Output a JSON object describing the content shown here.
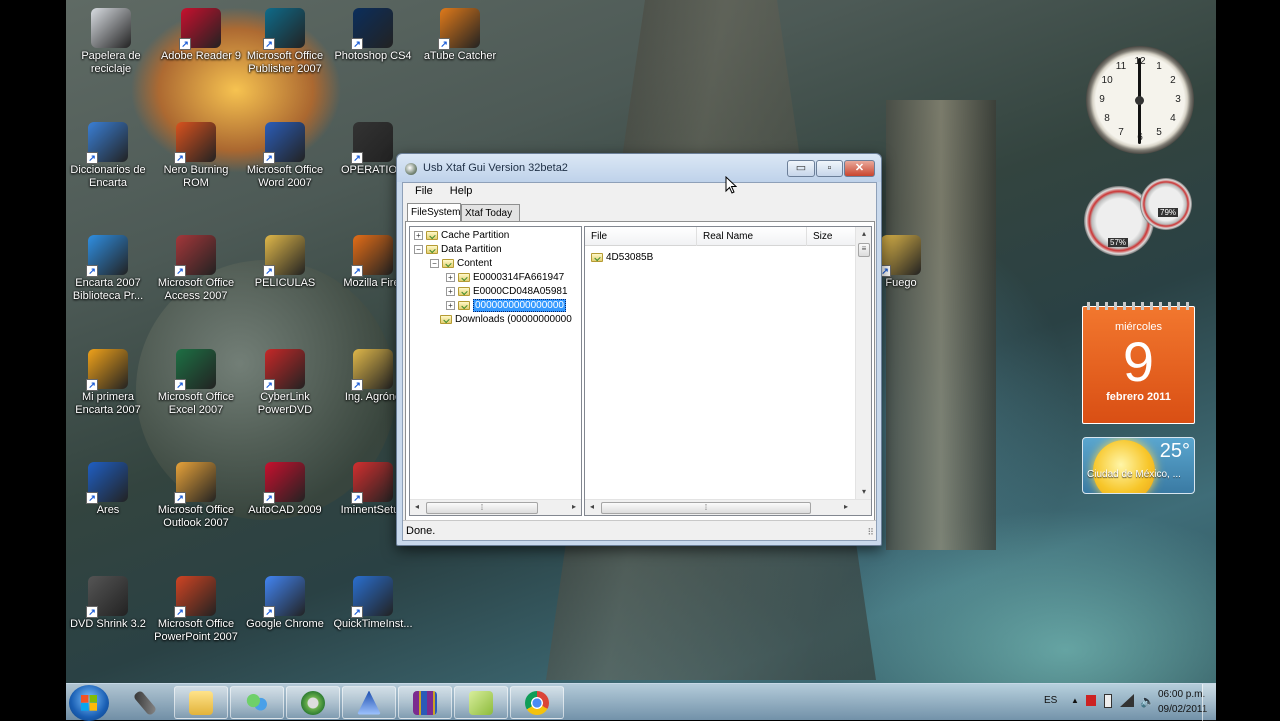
{
  "desktop": {
    "icons": [
      {
        "label": "Papelera de reciclaje"
      },
      {
        "label": "Adobe Reader 9"
      },
      {
        "label": "Microsoft Office Publisher 2007"
      },
      {
        "label": "Photoshop CS4"
      },
      {
        "label": "aTube Catcher"
      },
      {
        "label": "Diccionarios de Encarta"
      },
      {
        "label": "Nero Burning ROM"
      },
      {
        "label": "Microsoft Office Word 2007"
      },
      {
        "label": "OPERATION"
      },
      {
        "label": "Encarta 2007 Biblioteca Pr..."
      },
      {
        "label": "Microsoft Office Access 2007"
      },
      {
        "label": "PELICULAS"
      },
      {
        "label": "Mozilla Firef"
      },
      {
        "label": "Fuego"
      },
      {
        "label": "Mi primera Encarta 2007"
      },
      {
        "label": "Microsoft Office Excel 2007"
      },
      {
        "label": "CyberLink PowerDVD"
      },
      {
        "label": "Ing. Agróno"
      },
      {
        "label": "Ares"
      },
      {
        "label": "Microsoft Office Outlook 2007"
      },
      {
        "label": "AutoCAD 2009"
      },
      {
        "label": "IminentSetup"
      },
      {
        "label": "DVD Shrink 3.2"
      },
      {
        "label": "Microsoft Office PowerPoint 2007"
      },
      {
        "label": "Google Chrome"
      },
      {
        "label": "QuickTimeInst..."
      }
    ]
  },
  "window": {
    "title": "Usb Xtaf Gui Version 32beta2",
    "controls": {
      "minimize": "▭",
      "maximize": "▫",
      "close": "✕"
    },
    "menu": [
      "File",
      "Help"
    ],
    "tabs": [
      "FileSystem",
      "Xtaf Today"
    ],
    "tree": {
      "nodes": [
        {
          "label": "Cache Partition",
          "toggle": "+"
        },
        {
          "label": "Data Partition",
          "toggle": "−"
        },
        {
          "label": "Content",
          "toggle": "−"
        },
        {
          "label": "E0000314FA661947",
          "toggle": "+"
        },
        {
          "label": "E0000CD048A05981",
          "toggle": "+"
        },
        {
          "label": "0000000000000000",
          "toggle": "+"
        },
        {
          "label": "Downloads (00000000000",
          "toggle": ""
        }
      ]
    },
    "list": {
      "columns": [
        "File",
        "Real Name",
        "Size"
      ],
      "rows": [
        "4D53085B"
      ]
    },
    "status": "Done."
  },
  "gadgets": {
    "clock": {
      "numbers": [
        "12",
        "1",
        "2",
        "3",
        "4",
        "5",
        "6",
        "7",
        "8",
        "9",
        "10",
        "11"
      ],
      "time": "06:00"
    },
    "meter": {
      "cpu": "57%",
      "mem": "79%"
    },
    "calendar": {
      "weekday": "miércoles",
      "day": "9",
      "month_year": "febrero 2011"
    },
    "weather": {
      "temp": "25°",
      "city": "Ciudad de México, ..."
    }
  },
  "taskbar": {
    "lang": "ES",
    "time": "06:00 p.m.",
    "date": "09/02/2011",
    "buttons": [
      "start-orb",
      "microphone",
      "explorer",
      "messenger",
      "xbox",
      "ares",
      "winrar",
      "folder",
      "chrome"
    ]
  }
}
